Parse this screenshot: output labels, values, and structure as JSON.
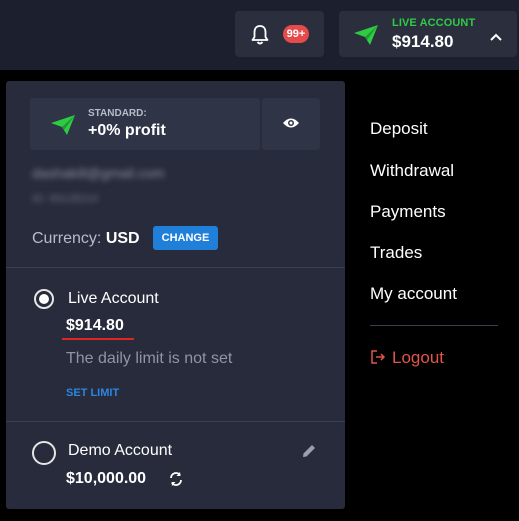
{
  "header": {
    "notifications_badge": "99+",
    "account_type": "LIVE ACCOUNT",
    "account_balance": "$914.80"
  },
  "profile": {
    "plan_label": "STANDARD:",
    "plan_value": "+0% profit",
    "email_blurred": "dashakill@gmail.com",
    "id_blurred": "ID: 99128214",
    "currency_label": "Currency:",
    "currency_value": "USD",
    "change_label": "CHANGE"
  },
  "accounts": [
    {
      "name": "Live Account",
      "balance": "$914.80",
      "limit_text": "The daily limit is not set",
      "set_limit_label": "SET LIMIT",
      "selected": true
    },
    {
      "name": "Demo Account",
      "balance": "$10,000.00",
      "selected": false
    }
  ],
  "menu": {
    "items": [
      "Deposit",
      "Withdrawal",
      "Payments",
      "Trades",
      "My account"
    ],
    "logout": "Logout"
  },
  "colors": {
    "accent_green": "#2fcb43",
    "accent_blue": "#1f7fd9",
    "logout_red": "#e05548"
  },
  "icons": [
    "bell-icon",
    "paper-plane-icon",
    "chevron-up-icon",
    "eye-icon",
    "pencil-icon",
    "refresh-icon",
    "logout-icon"
  ]
}
